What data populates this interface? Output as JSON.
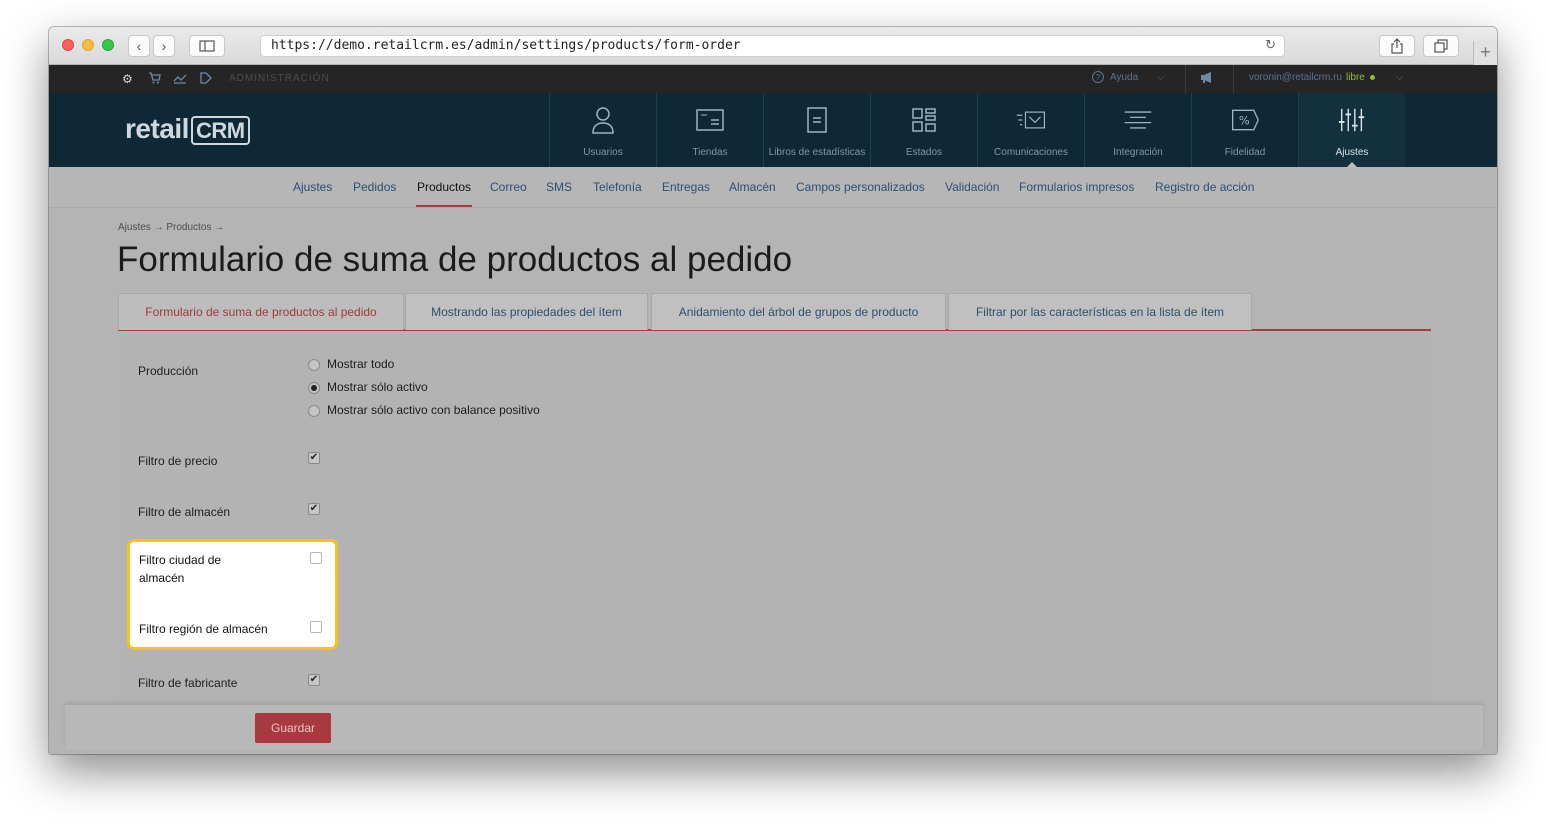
{
  "browser": {
    "url": "https://demo.retailcrm.es/admin/settings/products/form-order"
  },
  "adminbar": {
    "section": "ADMINISTRACIÓN",
    "help": "Ayuda",
    "user": "voronin@retailcrm.ru",
    "plan": "libre"
  },
  "logo": {
    "text": "retail",
    "crm": "CRM"
  },
  "mainnav": [
    {
      "label": "Usuarios",
      "icon": "user-icon"
    },
    {
      "label": "Tiendas",
      "icon": "store-icon"
    },
    {
      "label": "Libros de estadísticas",
      "icon": "book-icon"
    },
    {
      "label": "Estados",
      "icon": "grid-icon"
    },
    {
      "label": "Comunicaciones",
      "icon": "mail-icon"
    },
    {
      "label": "Integración",
      "icon": "integration-icon"
    },
    {
      "label": "Fidelidad",
      "icon": "percent-tag-icon"
    },
    {
      "label": "Ajustes",
      "icon": "sliders-icon",
      "active": true
    }
  ],
  "subnav": [
    "Ajustes",
    "Pedidos",
    "Productos",
    "Correo",
    "SMS",
    "Telefonía",
    "Entregas",
    "Almacén",
    "Campos personalizados",
    "Validación",
    "Formularios impresos",
    "Registro de acción"
  ],
  "subnav_active": "Productos",
  "breadcrumb": "Ajustes → Productos →",
  "title": "Formulario de suma de productos al pedido",
  "tabs": [
    "Formulario de suma de productos al pedido",
    "Mostrando las propiedades del ítem",
    "Anidamiento del árbol de grupos de producto",
    "Filtrar por las características en la lista de ítem"
  ],
  "form": {
    "produccion_label": "Producción",
    "radio_options": [
      "Mostrar todo",
      "Mostrar sólo activo",
      "Mostrar sólo activo con balance positivo"
    ],
    "radio_selected": "Mostrar sólo activo",
    "fields": [
      {
        "label": "Filtro de precio",
        "checked": true
      },
      {
        "label": "Filtro de almacén",
        "checked": true
      },
      {
        "label": "Filtro ciudad de almacén",
        "checked": false
      },
      {
        "label": "Filtro región de almacén",
        "checked": false
      },
      {
        "label": "Filtro de fabricante",
        "checked": true
      }
    ],
    "save_label": "Guardar"
  },
  "colors": {
    "accent_red": "#a8393f",
    "highlight_border": "#f4c41b",
    "nav_bg": "#0e2835"
  }
}
